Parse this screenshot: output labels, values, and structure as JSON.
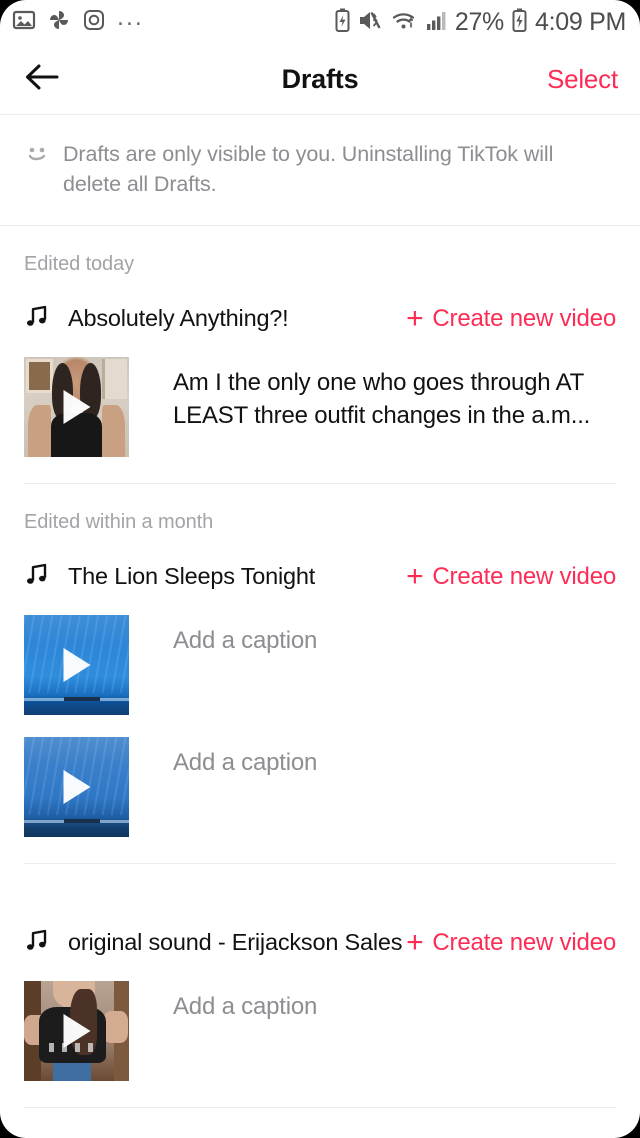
{
  "theme": {
    "accent": "#fe2c55",
    "text": "#121212",
    "muted": "#8d8d92",
    "section": "#a3a3a8"
  },
  "statusbar": {
    "left_icons": [
      "image-icon",
      "pinwheel-icon",
      "instagram-icon"
    ],
    "overflow": "...",
    "right_icons": [
      "battery-saver-icon",
      "mute-icon",
      "wifi-icon",
      "signal-icon",
      "charging-battery-icon"
    ],
    "battery_percent": "27%",
    "time": "4:09 PM"
  },
  "header": {
    "back_icon": "back-arrow-icon",
    "title": "Drafts",
    "select_label": "Select"
  },
  "notice": {
    "icon": "smiley-icon",
    "text": "Drafts are only visible to you. Uninstalling TikTok will delete all Drafts."
  },
  "create_label": "Create new video",
  "plus": "+",
  "sections": [
    {
      "label": "Edited today",
      "sound": "Absolutely Anything?!",
      "drafts": [
        {
          "caption": "Am I the only one who goes through AT LEAST three outfit changes in the a.m...",
          "is_placeholder": false
        }
      ]
    },
    {
      "label": "Edited within a month",
      "sound": "The Lion Sleeps Tonight",
      "drafts": [
        {
          "caption": "Add a caption",
          "is_placeholder": true
        },
        {
          "caption": "Add a caption",
          "is_placeholder": true
        }
      ]
    },
    {
      "label": "",
      "sound": "original sound - Erijackson Sales",
      "drafts": [
        {
          "caption": "Add a caption",
          "is_placeholder": true
        }
      ]
    }
  ]
}
